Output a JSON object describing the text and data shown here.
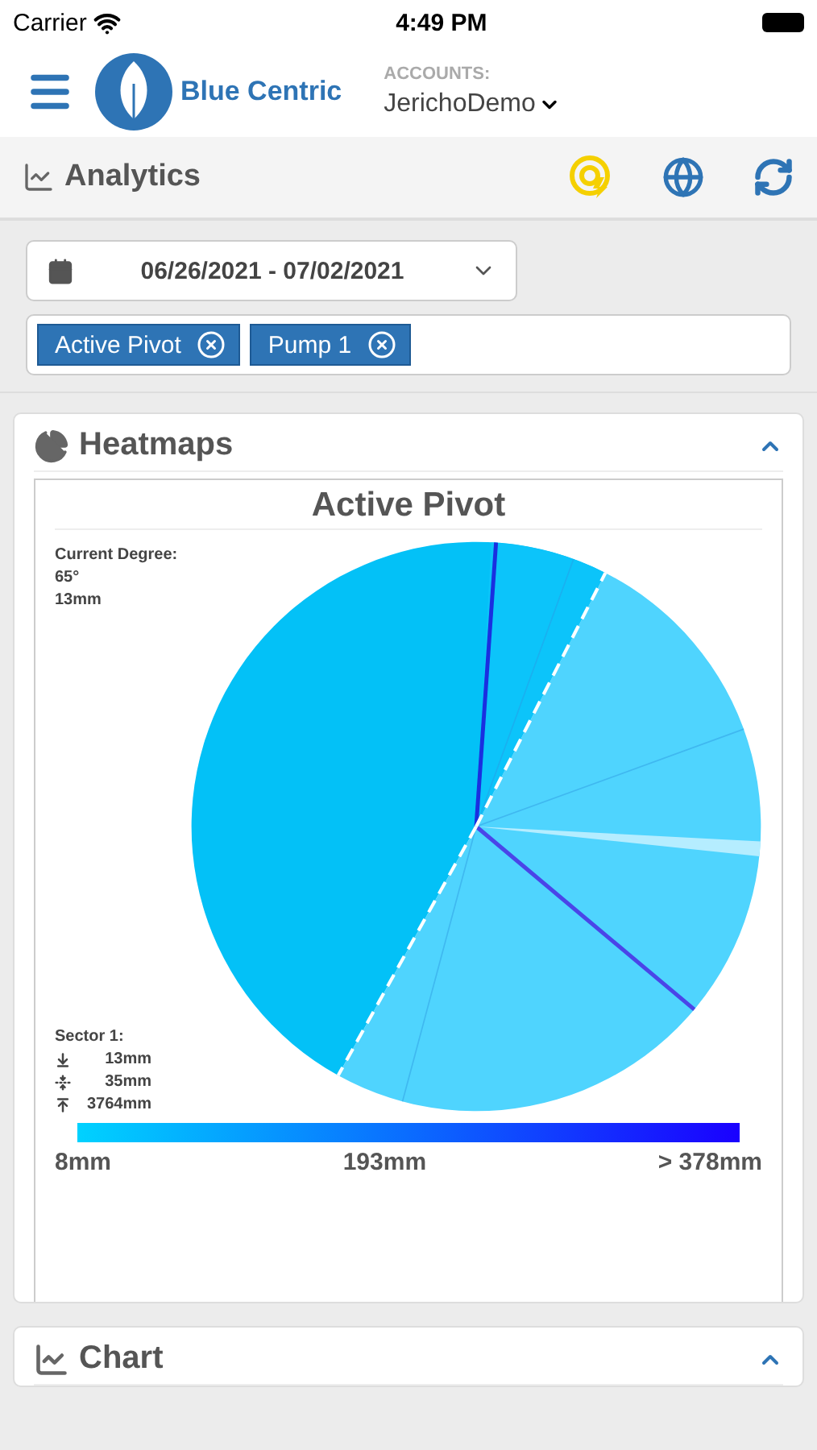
{
  "status_bar": {
    "carrier": "Carrier",
    "time": "4:49 PM"
  },
  "header": {
    "brand": "Blue Centric",
    "accounts_label": "ACCOUNTS:",
    "account": "JerichoDemo"
  },
  "toolbar": {
    "title": "Analytics"
  },
  "filters": {
    "date_range": "06/26/2021 - 07/02/2021",
    "tags": [
      {
        "label": "Active Pivot"
      },
      {
        "label": "Pump 1"
      }
    ]
  },
  "heatmaps": {
    "title": "Heatmaps",
    "expanded": true,
    "pivot_title": "Active Pivot",
    "current": [
      "Current Degree:",
      "65°",
      "13mm"
    ],
    "sector": {
      "title": "Sector 1:",
      "stats": [
        {
          "kind": "min",
          "value": "13mm"
        },
        {
          "kind": "avg",
          "value": "35mm"
        },
        {
          "kind": "max",
          "value": "3764mm"
        }
      ]
    },
    "legend": [
      "8mm",
      "193mm",
      "> 378mm"
    ]
  },
  "chart_card": {
    "title": "Chart",
    "expanded": true
  }
}
